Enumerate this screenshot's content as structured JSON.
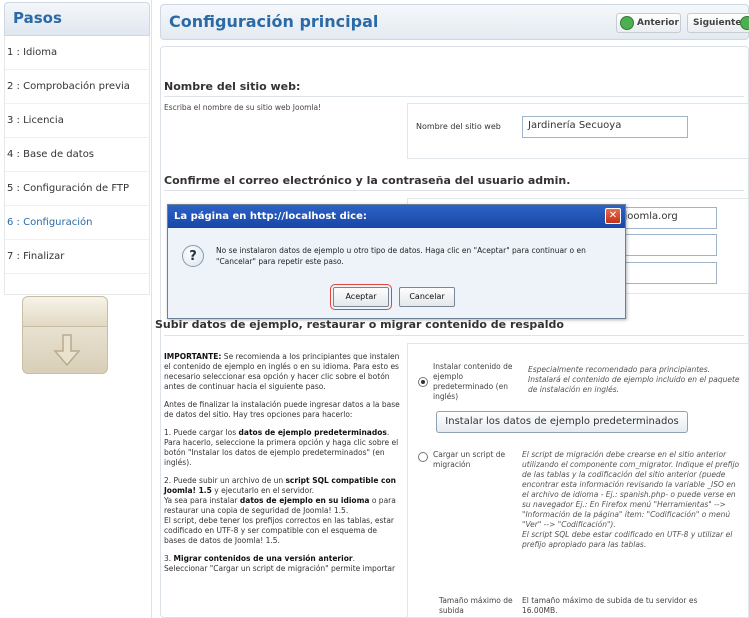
{
  "sidebar": {
    "title": "Pasos",
    "items": [
      {
        "label": "1 : Idioma"
      },
      {
        "label": "2 : Comprobación previa"
      },
      {
        "label": "3 : Licencia"
      },
      {
        "label": "4 : Base de datos"
      },
      {
        "label": "5 : Configuración de FTP"
      },
      {
        "label": "6 : Configuración"
      },
      {
        "label": "7 : Finalizar"
      }
    ]
  },
  "header": {
    "title": "Configuración principal",
    "prev_label": "Anterior",
    "next_label": "Siguiente"
  },
  "site": {
    "section_title": "Nombre del sitio web:",
    "help": "Escriba el nombre de su sitio web Joomla!",
    "field_label": "Nombre del sitio web",
    "field_value": "Jardinería Secuoya"
  },
  "admin": {
    "section_title": "Confirme el correo electrónico y la contraseña del usuario admin.",
    "email_value": "adjoomla.org"
  },
  "sample": {
    "section_title": "Subir datos de ejemplo, restaurar o migrar contenido de respaldo",
    "p1_bold": "IMPORTANTE:",
    "p1": " Se recomienda a los principiantes que instalen el contenido de ejemplo en inglés o en su idioma. Para esto es necesario seleccionar esa opción y hacer clic sobre el botón antes de continuar hacia el siguiente paso.",
    "p2": "Antes de finalizar la instalación puede ingresar datos a la base de datos del sitio. Hay tres opciones para hacerlo:",
    "p3_a": "1. Puede cargar los ",
    "p3_b": "datos de ejemplo predeterminados",
    "p3_c": ". Para hacerlo, seleccione la primera opción y haga clic sobre el botón \"Instalar los datos de ejemplo predeterminados\" (en inglés).",
    "p4_a": "2. Puede subir un archivo de un ",
    "p4_b": "script SQL compatible con Joomla! 1.5",
    "p4_c": " y ejecutarlo en el servidor.",
    "p4_d": "Ya sea para instalar ",
    "p4_e": "datos de ejemplo en su idioma",
    "p4_f": " o para restaurar una copia de seguridad de Joomla! 1.5.",
    "p4_g": "El script, debe tener los prefijos correctos en las tablas, estar codificado en UTF-8 y ser compatible con el esquema de bases de datos de Joomla! 1.5.",
    "p5_a": "3. ",
    "p5_b": "Migrar contenidos de una versión anterior",
    "p5_c": ".",
    "p5_d": "Seleccionar \"Cargar un script de migración\" permite importar",
    "opt1_label": "Instalar contenido de ejemplo predeterminado (en inglés)",
    "opt1_desc": "Especialmente recomendado para principiantes. Instalará el contenido de ejemplo incluido en el paquete de instalación en inglés.",
    "install_button": "Instalar los datos de ejemplo predeterminados",
    "opt2_label": "Cargar un script de migración",
    "opt2_desc": "El script de migración debe crearse en el sitio anterior utilizando el componente com_migrator. Indique el prefijo de las tablas y la codificación del sitio anterior (puede encontrar esta información revisando la variable _ISO en el archivo de idioma - Ej.: spanish.php- o puede verse en su navegador Ej.: En Firefox menú \"Herramientas\" --> \"Información de la página\" ítem: \"Codificación\" o menú \"Ver\" --> \"Codificación\").",
    "opt2_desc2": "El script SQL debe estar codificado en UTF-8 y utilizar el prefijo apropiado para las tablas.",
    "max_label": "Tamaño máximo de subida",
    "max_desc": "El tamaño máximo de subida de tu servidor es 16.00MB."
  },
  "dialog": {
    "title": "La página en http://localhost dice:",
    "message": "No se instalaron datos de ejemplo u otro tipo de datos. Haga clic en \"Aceptar\" para continuar o en \"Cancelar\" para repetir este paso.",
    "ok_label": "Aceptar",
    "cancel_label": "Cancelar"
  }
}
